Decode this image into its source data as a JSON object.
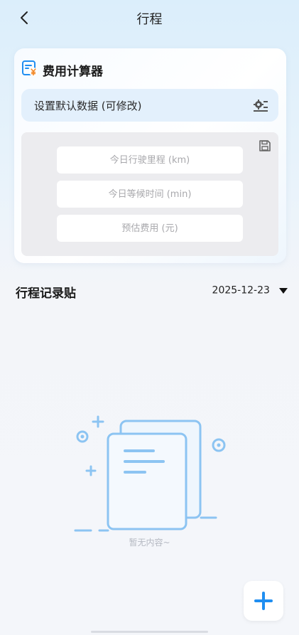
{
  "header": {
    "title": "行程",
    "back_icon": "chevron-left-icon"
  },
  "calculator": {
    "title": "费用计算器",
    "title_icon": "calculator-yen-icon",
    "defaults_label": "设置默认数据 (可修改)",
    "settings_icon": "settings-list-icon",
    "save_icon": "floppy-disk-icon",
    "fields": [
      {
        "placeholder": "今日行驶里程 (km)",
        "value": ""
      },
      {
        "placeholder": "今日等候时间 (min)",
        "value": ""
      },
      {
        "placeholder": "预估费用 (元)",
        "value": ""
      }
    ]
  },
  "records": {
    "title": "行程记录贴",
    "date": "2025-12-23",
    "date_caret_icon": "caret-down-icon",
    "empty_text": "暂无内容~",
    "empty_icon": "empty-documents-icon"
  },
  "fab": {
    "icon": "plus-icon"
  },
  "colors": {
    "accent": "#1f8ef1",
    "accent_light": "#e3f0fc",
    "illustration_stroke": "#8cc4f2",
    "yen_orange": "#f28a2a"
  }
}
